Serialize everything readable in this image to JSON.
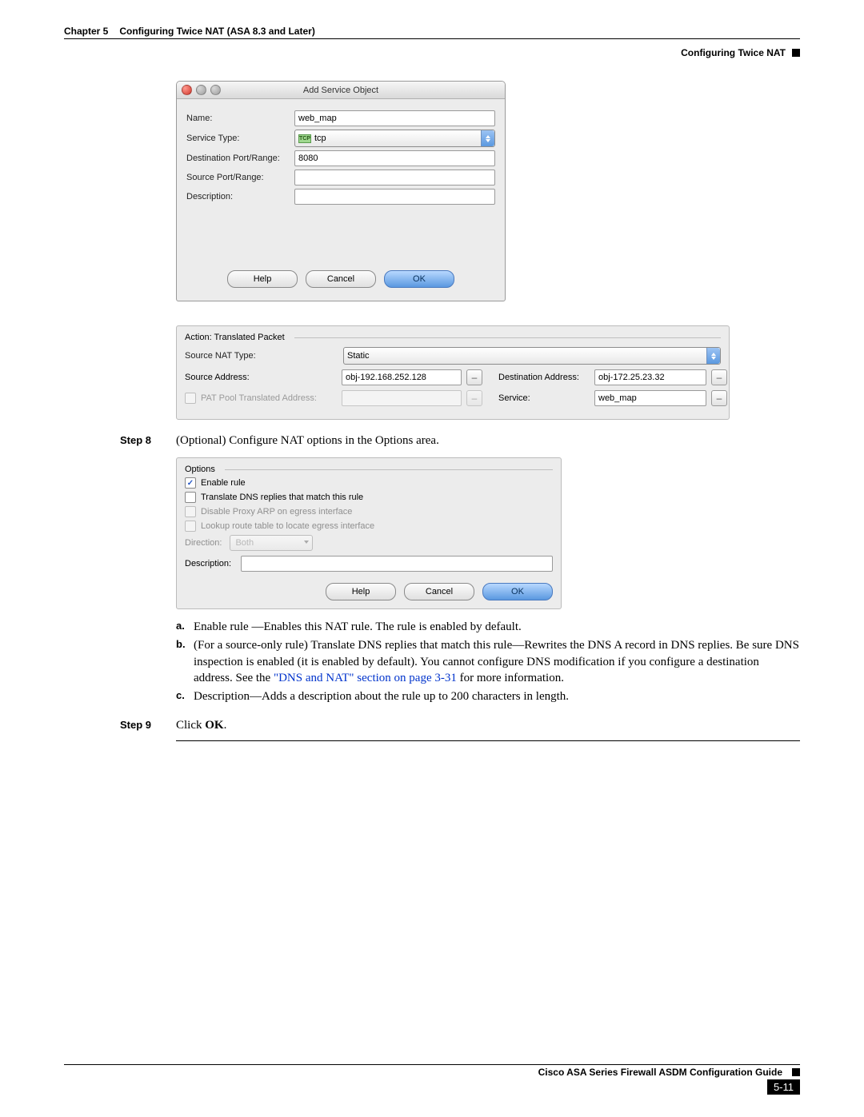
{
  "header": {
    "chapter": "Chapter 5",
    "chapter_title": "Configuring Twice NAT (ASA 8.3 and Later)",
    "section": "Configuring Twice NAT"
  },
  "dialog": {
    "title": "Add Service Object",
    "fields": {
      "name_label": "Name:",
      "name_value": "web_map",
      "service_type_label": "Service Type:",
      "service_type_value": "tcp",
      "dest_port_label": "Destination Port/Range:",
      "dest_port_value": "8080",
      "source_port_label": "Source Port/Range:",
      "desc_label": "Description:"
    },
    "buttons": {
      "help": "Help",
      "cancel": "Cancel",
      "ok": "OK"
    }
  },
  "action_panel": {
    "legend": "Action: Translated Packet",
    "source_nat_label": "Source NAT Type:",
    "source_nat_value": "Static",
    "source_addr_label": "Source Address:",
    "source_addr_value": "obj-192.168.252.128",
    "dest_addr_label": "Destination Address:",
    "dest_addr_value": "obj-172.25.23.32",
    "pat_label": "PAT Pool Translated Address:",
    "service_label": "Service:",
    "service_value": "web_map"
  },
  "step8": {
    "label": "Step 8",
    "text": "(Optional) Configure NAT options in the Options area."
  },
  "options_panel": {
    "legend": "Options",
    "rows": {
      "enable": "Enable rule",
      "translate_dns": "Translate DNS replies that match this rule",
      "disable_arp": "Disable Proxy ARP on egress interface",
      "lookup_route": "Lookup route table to locate egress interface"
    },
    "direction_label": "Direction:",
    "direction_value": "Both",
    "description_label": "Description:",
    "buttons": {
      "help": "Help",
      "cancel": "Cancel",
      "ok": "OK"
    }
  },
  "bullets": {
    "a": {
      "letter": "a.",
      "text": "Enable rule —Enables this NAT rule. The rule is enabled by default."
    },
    "b": {
      "letter": "b.",
      "text_before": "(For a source-only rule) Translate DNS replies that match this rule—Rewrites the DNS A record in DNS replies. Be sure DNS inspection is enabled (it is enabled by default). You cannot configure DNS modification if you configure a destination address. See the ",
      "link": "\"DNS and NAT\" section on page 3-31",
      "text_after": " for more information."
    },
    "c": {
      "letter": "c.",
      "text": "Description—Adds a description about the rule up to 200 characters in length."
    }
  },
  "step9": {
    "label": "Step 9",
    "text_before": "Click ",
    "bold": "OK",
    "text_after": "."
  },
  "footer": {
    "guide": "Cisco ASA Series Firewall ASDM Configuration Guide",
    "page": "5-11"
  }
}
